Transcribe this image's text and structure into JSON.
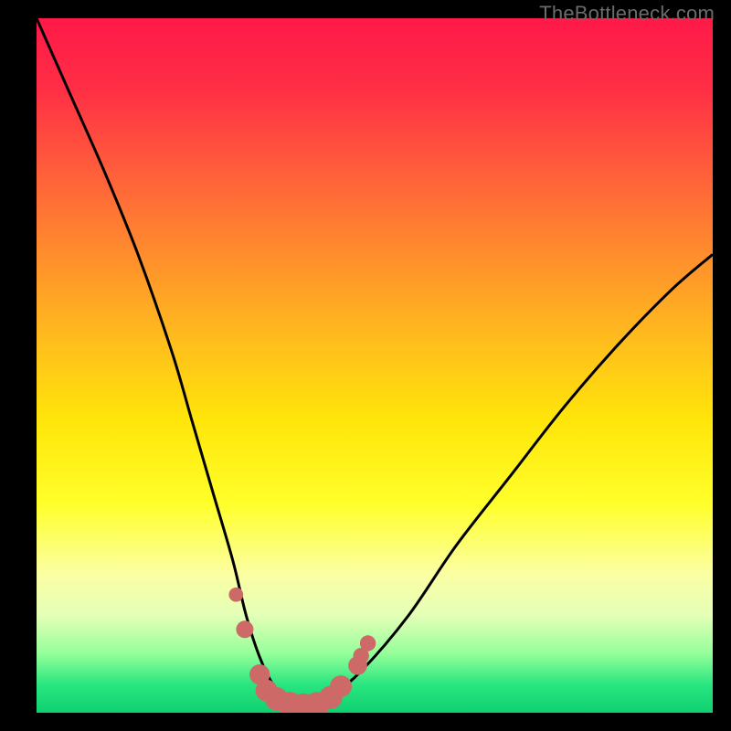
{
  "watermark": "TheBottleneck.com",
  "colors": {
    "gradient_stops": [
      {
        "offset": 0.0,
        "color": "#ff1948"
      },
      {
        "offset": 0.1,
        "color": "#ff2e45"
      },
      {
        "offset": 0.25,
        "color": "#ff6a38"
      },
      {
        "offset": 0.45,
        "color": "#ffb81f"
      },
      {
        "offset": 0.58,
        "color": "#ffe60a"
      },
      {
        "offset": 0.7,
        "color": "#ffff2b"
      },
      {
        "offset": 0.8,
        "color": "#fbffa3"
      },
      {
        "offset": 0.86,
        "color": "#e4ffb7"
      },
      {
        "offset": 0.915,
        "color": "#94ff9a"
      },
      {
        "offset": 0.96,
        "color": "#28e57f"
      },
      {
        "offset": 1.0,
        "color": "#0fd071"
      }
    ],
    "curve": "#000000",
    "marker_fill": "#cd6a67",
    "marker_stroke": "#b85552"
  },
  "chart_data": {
    "type": "line",
    "title": "",
    "xlabel": "",
    "ylabel": "",
    "xlim": [
      0,
      100
    ],
    "ylim": [
      0,
      100
    ],
    "grid": false,
    "legend": false,
    "series": [
      {
        "name": "bottleneck-curve",
        "x": [
          0,
          5,
          10,
          15,
          20,
          23,
          26,
          29,
          31,
          33,
          35,
          37,
          40,
          43,
          48,
          55,
          62,
          70,
          78,
          86,
          94,
          100
        ],
        "values": [
          100,
          89,
          78,
          66,
          52,
          42,
          32,
          22,
          14,
          8,
          4,
          2,
          1,
          2,
          6,
          14,
          24,
          34,
          44,
          53,
          61,
          66
        ]
      }
    ],
    "markers": [
      {
        "x": 29.5,
        "y": 17,
        "r": 1.2
      },
      {
        "x": 30.8,
        "y": 12,
        "r": 1.6
      },
      {
        "x": 33.0,
        "y": 5.5,
        "r": 2.0
      },
      {
        "x": 34.0,
        "y": 3.2,
        "r": 2.2
      },
      {
        "x": 35.5,
        "y": 2.0,
        "r": 2.4
      },
      {
        "x": 37.5,
        "y": 1.2,
        "r": 2.6
      },
      {
        "x": 39.5,
        "y": 1.0,
        "r": 2.6
      },
      {
        "x": 41.5,
        "y": 1.2,
        "r": 2.6
      },
      {
        "x": 43.5,
        "y": 2.2,
        "r": 2.4
      },
      {
        "x": 45.0,
        "y": 3.8,
        "r": 2.2
      },
      {
        "x": 47.5,
        "y": 6.8,
        "r": 1.8
      },
      {
        "x": 48.0,
        "y": 8.2,
        "r": 1.4
      },
      {
        "x": 49.0,
        "y": 10.0,
        "r": 1.4
      }
    ]
  }
}
